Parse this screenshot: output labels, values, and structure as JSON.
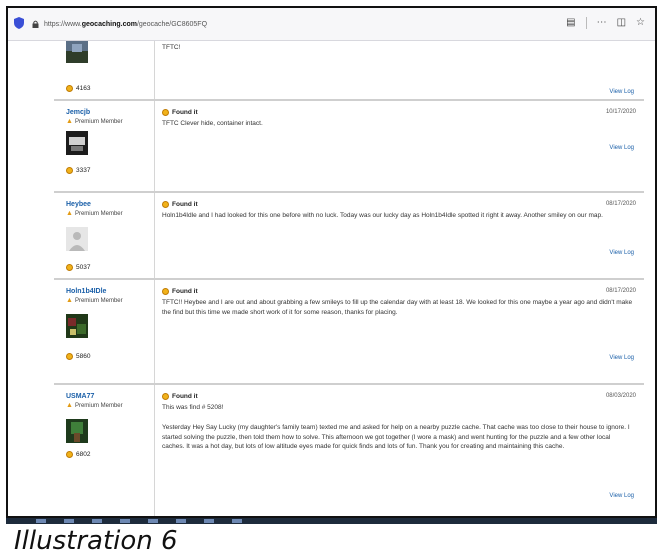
{
  "browser": {
    "url_prefix": "https://www.",
    "url_domain": "geocaching.com",
    "url_path": "/geocache/GC8605FQ"
  },
  "logs": [
    {
      "username": "",
      "member": "",
      "finds": "4163",
      "type": "",
      "date": "",
      "text": "TFTC!",
      "view_log": "View Log"
    },
    {
      "username": "Jemcjb",
      "member": "Premium Member",
      "finds": "3337",
      "type": "Found it",
      "date": "10/17/2020",
      "text": "TFTC Clever hide, container intact.",
      "view_log": "View Log"
    },
    {
      "username": "Heybee",
      "member": "Premium Member",
      "finds": "5037",
      "type": "Found it",
      "date": "08/17/2020",
      "text": "Holn1b4Idle and I had looked for this one before with no luck. Today was our lucky day as Holn1b4Idle spotted it right it away. Another smiley on our map.",
      "view_log": "View Log"
    },
    {
      "username": "Holn1b4IDle",
      "member": "Premium Member",
      "finds": "5860",
      "type": "Found it",
      "date": "08/17/2020",
      "text": "TFTC!! Heybee and I are out and about grabbing a few smileys to fill up the calendar day with at least 18. We looked for this one maybe a year ago and didn't make the find but this time we made short work of it for some reason, thanks for placing.",
      "view_log": "View Log"
    },
    {
      "username": "USMA77",
      "member": "Premium Member",
      "finds": "6802",
      "type": "Found it",
      "date": "08/03/2020",
      "text": "This was find # 5208!",
      "text2": "Yesterday Hey Say Lucky (my daughter's family team) texted me and asked for help on a nearby puzzle cache. That cache was too close to their house to ignore. I started solving the puzzle, then told them how to solve. This afternoon we got together (I wore a mask) and went hunting for the puzzle and a few other local caches. It was a hot day, but lots of low altitude eyes made for quick finds and lots of fun. Thank you for creating and maintaining this cache.",
      "view_log": "View Log"
    }
  ],
  "caption": "Illustration 6",
  "colors": {
    "link": "#1a5fa8",
    "smiley": "#f1b21a",
    "premium": "#e39b14"
  }
}
